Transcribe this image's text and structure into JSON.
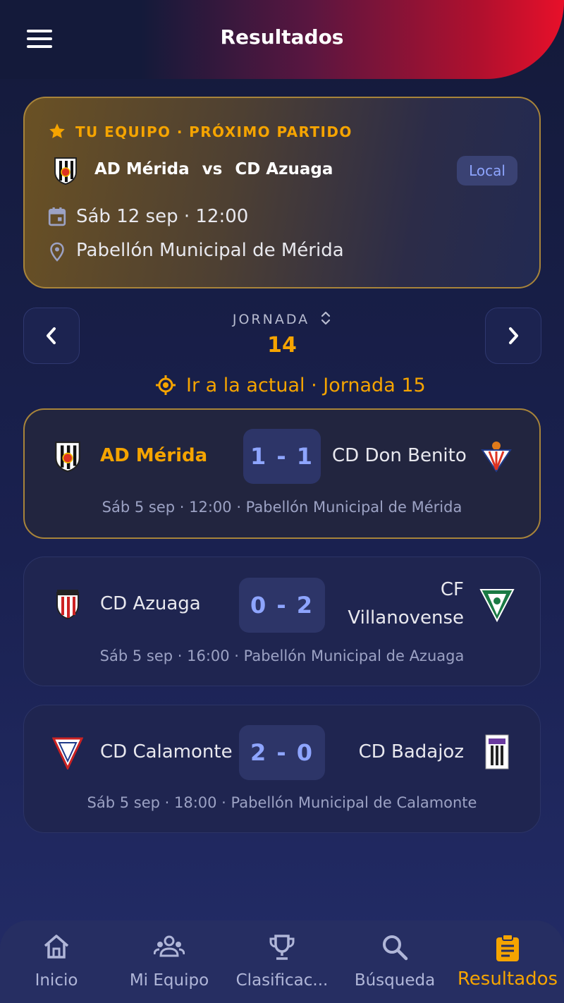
{
  "header": {
    "title": "Resultados"
  },
  "next_match": {
    "label": "TU EQUIPO · PRÓXIMO PARTIDO",
    "home": "AD Mérida",
    "vs": "vs",
    "away": "CD Azuaga",
    "badge": "Local",
    "date": "Sáb 12 sep · 12:00",
    "venue": "Pabellón Municipal de Mérida"
  },
  "jornada": {
    "label": "JORNADA",
    "number": "14",
    "goto_current": "Ir a la actual · Jornada 15"
  },
  "matches": [
    {
      "home": "AD Mérida",
      "away": "CD Don Benito",
      "score": "1 - 1",
      "meta": "Sáb 5 sep · 12:00 · Pabellón Municipal de Mérida"
    },
    {
      "home": "CD Azuaga",
      "away_line1": "CF",
      "away_line2": "Villanovense",
      "score": "0 - 2",
      "meta": "Sáb 5 sep · 16:00 · Pabellón Municipal de Azuaga"
    },
    {
      "home": "CD Calamonte",
      "away": "CD Badajoz",
      "score": "2 - 0",
      "meta": "Sáb 5 sep · 18:00 · Pabellón Municipal de Calamonte"
    }
  ],
  "bottom_nav": [
    {
      "label": "Inicio",
      "icon": "home-icon"
    },
    {
      "label": "Mi Equipo",
      "icon": "group-icon"
    },
    {
      "label": "Clasificac...",
      "icon": "trophy-icon"
    },
    {
      "label": "Búsqueda",
      "icon": "search-icon"
    },
    {
      "label": "Resultados",
      "icon": "clipboard-icon",
      "active": true
    }
  ],
  "colors": {
    "accent": "#f5a400",
    "score": "#8ea5ff",
    "background": "#1a2150"
  }
}
